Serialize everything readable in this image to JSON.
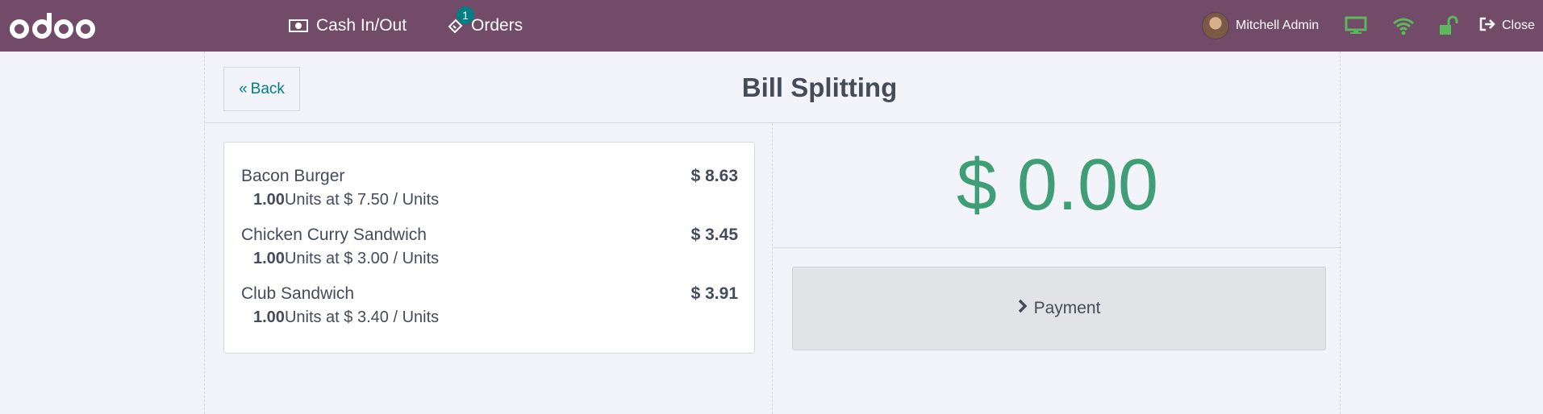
{
  "navbar": {
    "logo": "odoo",
    "cash_label": "Cash In/Out",
    "orders_label": "Orders",
    "orders_badge": "1",
    "user_name": "Mitchell Admin",
    "close_label": "Close"
  },
  "screen": {
    "back_label": "Back",
    "title": "Bill Splitting"
  },
  "orderlines": [
    {
      "name": "Bacon Burger",
      "price": "$ 8.63",
      "qty": "1.00",
      "detail": "Units at $ 7.50 / Units"
    },
    {
      "name": "Chicken Curry Sandwich",
      "price": "$ 3.45",
      "qty": "1.00",
      "detail": "Units at $ 3.00 / Units"
    },
    {
      "name": "Club Sandwich",
      "price": "$ 3.91",
      "qty": "1.00",
      "detail": "Units at $ 3.40 / Units"
    }
  ],
  "summary": {
    "total": "$ 0.00",
    "payment_label": "Payment"
  },
  "colors": {
    "navbar": "#714b67",
    "accent": "#017e84",
    "total": "#3f9e75",
    "status_ok": "#5cb85c"
  },
  "icons": [
    "money-icon",
    "orders-icon",
    "monitor-icon",
    "wifi-icon",
    "unlock-icon",
    "sign-out-icon",
    "double-chevron-left-icon",
    "chevron-right-icon"
  ]
}
